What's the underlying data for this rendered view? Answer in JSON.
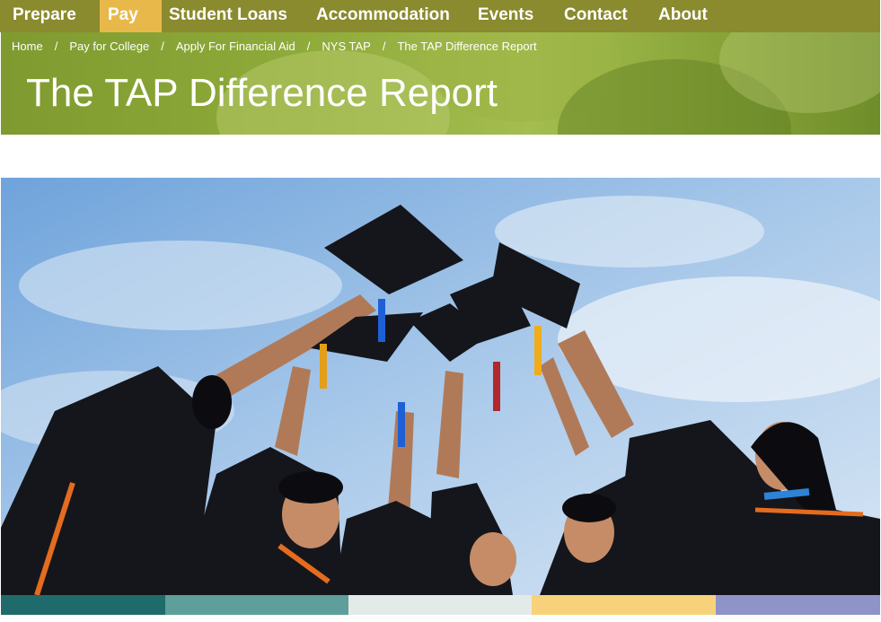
{
  "nav": {
    "items": [
      {
        "label": "Prepare",
        "active": false
      },
      {
        "label": "Pay",
        "active": true
      },
      {
        "label": "Student Loans",
        "active": false
      },
      {
        "label": "Accommodation",
        "active": false
      },
      {
        "label": "Events",
        "active": false
      },
      {
        "label": "Contact",
        "active": false
      },
      {
        "label": "About",
        "active": false
      }
    ]
  },
  "breadcrumb": [
    "Home",
    "Pay for College",
    "Apply For Financial Aid",
    "NYS TAP",
    "The TAP Difference Report"
  ],
  "page": {
    "title": "The TAP Difference Report"
  },
  "colors": {
    "nav_bg": "#8a8a2e",
    "nav_active": "#e8b94a",
    "banner_green": "#8fab3a",
    "strip": [
      "#1f6b6b",
      "#5e9e9b",
      "#e3ebe8",
      "#f8d27a",
      "#8f93c8"
    ]
  },
  "hero": {
    "subject": "graduates raising mortarboard caps against a blue sky"
  }
}
